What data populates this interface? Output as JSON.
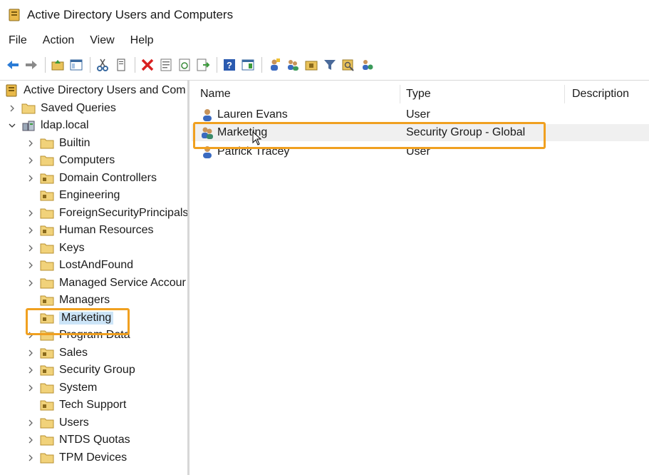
{
  "window": {
    "title": "Active Directory Users and Computers"
  },
  "menu": [
    "File",
    "Action",
    "View",
    "Help"
  ],
  "toolbar": {
    "icons": [
      "back-icon",
      "forward-icon",
      "up-folder-icon",
      "show-hide-tree-icon",
      "cut-icon",
      "copy-icon",
      "delete-icon",
      "properties-icon",
      "refresh-icon",
      "export-list-icon",
      "help-icon",
      "console-tree-icon",
      "new-user-icon",
      "new-group-icon",
      "new-ou-icon",
      "filter-icon",
      "find-icon",
      "add-to-group-icon"
    ]
  },
  "tree": {
    "root": "Active Directory Users and Com",
    "saved_queries": "Saved Queries",
    "domain": "ldap.local",
    "items": [
      "Builtin",
      "Computers",
      "Domain Controllers",
      "Engineering",
      "ForeignSecurityPrincipals",
      "Human Resources",
      "Keys",
      "LostAndFound",
      "Managed Service Accour",
      "Managers",
      "Marketing",
      "Program Data",
      "Sales",
      "Security Group",
      "System",
      "Tech Support",
      "Users",
      "NTDS Quotas",
      "TPM Devices"
    ]
  },
  "list": {
    "columns": [
      "Name",
      "Type",
      "Description"
    ],
    "rows": [
      {
        "name": "Lauren Evans",
        "type": "User",
        "description": ""
      },
      {
        "name": "Marketing",
        "type": "Security Group - Global",
        "description": ""
      },
      {
        "name": "Patrick Tracey",
        "type": "User",
        "description": ""
      }
    ]
  },
  "colors": {
    "highlight": "#f0a020",
    "selection": "#cce4f7"
  }
}
